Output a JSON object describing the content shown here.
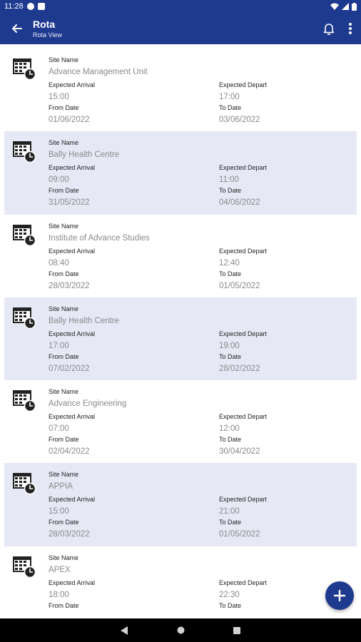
{
  "status_bar": {
    "time": "11:28",
    "left_icons": [
      "parking-icon",
      "sim-card-icon"
    ],
    "right_icons": [
      "wifi-icon",
      "signal-icon",
      "battery-icon"
    ]
  },
  "app_bar": {
    "title": "Rota",
    "subtitle": "Rota View",
    "icons": [
      "back-arrow-icon",
      "bell-icon",
      "more-vertical-icon"
    ]
  },
  "labels": {
    "site_name": "Site Name",
    "expected_arrival": "Expected Arrival",
    "expected_depart": "Expected Depart",
    "from_date": "From Date",
    "to_date": "To Date"
  },
  "rota_items": [
    {
      "site": "Advance Management Unit",
      "arrival": "15:00",
      "depart": "17:00",
      "from_date": "01/06/2022",
      "to_date": "03/06/2022",
      "highlighted": false
    },
    {
      "site": "Bally Health Centre",
      "arrival": "09:00",
      "depart": "11:00",
      "from_date": "31/05/2022",
      "to_date": "04/06/2022",
      "highlighted": true
    },
    {
      "site": "Institute of Advance Studies",
      "arrival": "08:40",
      "depart": "12:40",
      "from_date": "28/03/2022",
      "to_date": "01/05/2022",
      "highlighted": false
    },
    {
      "site": "Bally Health Centre",
      "arrival": "17:00",
      "depart": "19:00",
      "from_date": "07/02/2022",
      "to_date": "28/02/2022",
      "highlighted": true
    },
    {
      "site": "Advance Engineering",
      "arrival": "07:00",
      "depart": "12:00",
      "from_date": "02/04/2022",
      "to_date": "30/04/2022",
      "highlighted": false
    },
    {
      "site": "APPIA",
      "arrival": "15:00",
      "depart": "21:00",
      "from_date": "28/03/2022",
      "to_date": "01/05/2022",
      "highlighted": true
    },
    {
      "site": "APEX",
      "arrival": "18:00",
      "depart": "22:30",
      "from_date": "",
      "to_date": "",
      "highlighted": false
    }
  ],
  "fab": {
    "icon": "add-icon"
  },
  "nav_bar": {
    "icons": [
      "nav-back-icon",
      "nav-home-icon",
      "nav-recents-icon"
    ]
  },
  "colors": {
    "primary": "#1e3a8f",
    "highlight_row": "#e6e8f6",
    "value_text": "#8a8a8a"
  }
}
